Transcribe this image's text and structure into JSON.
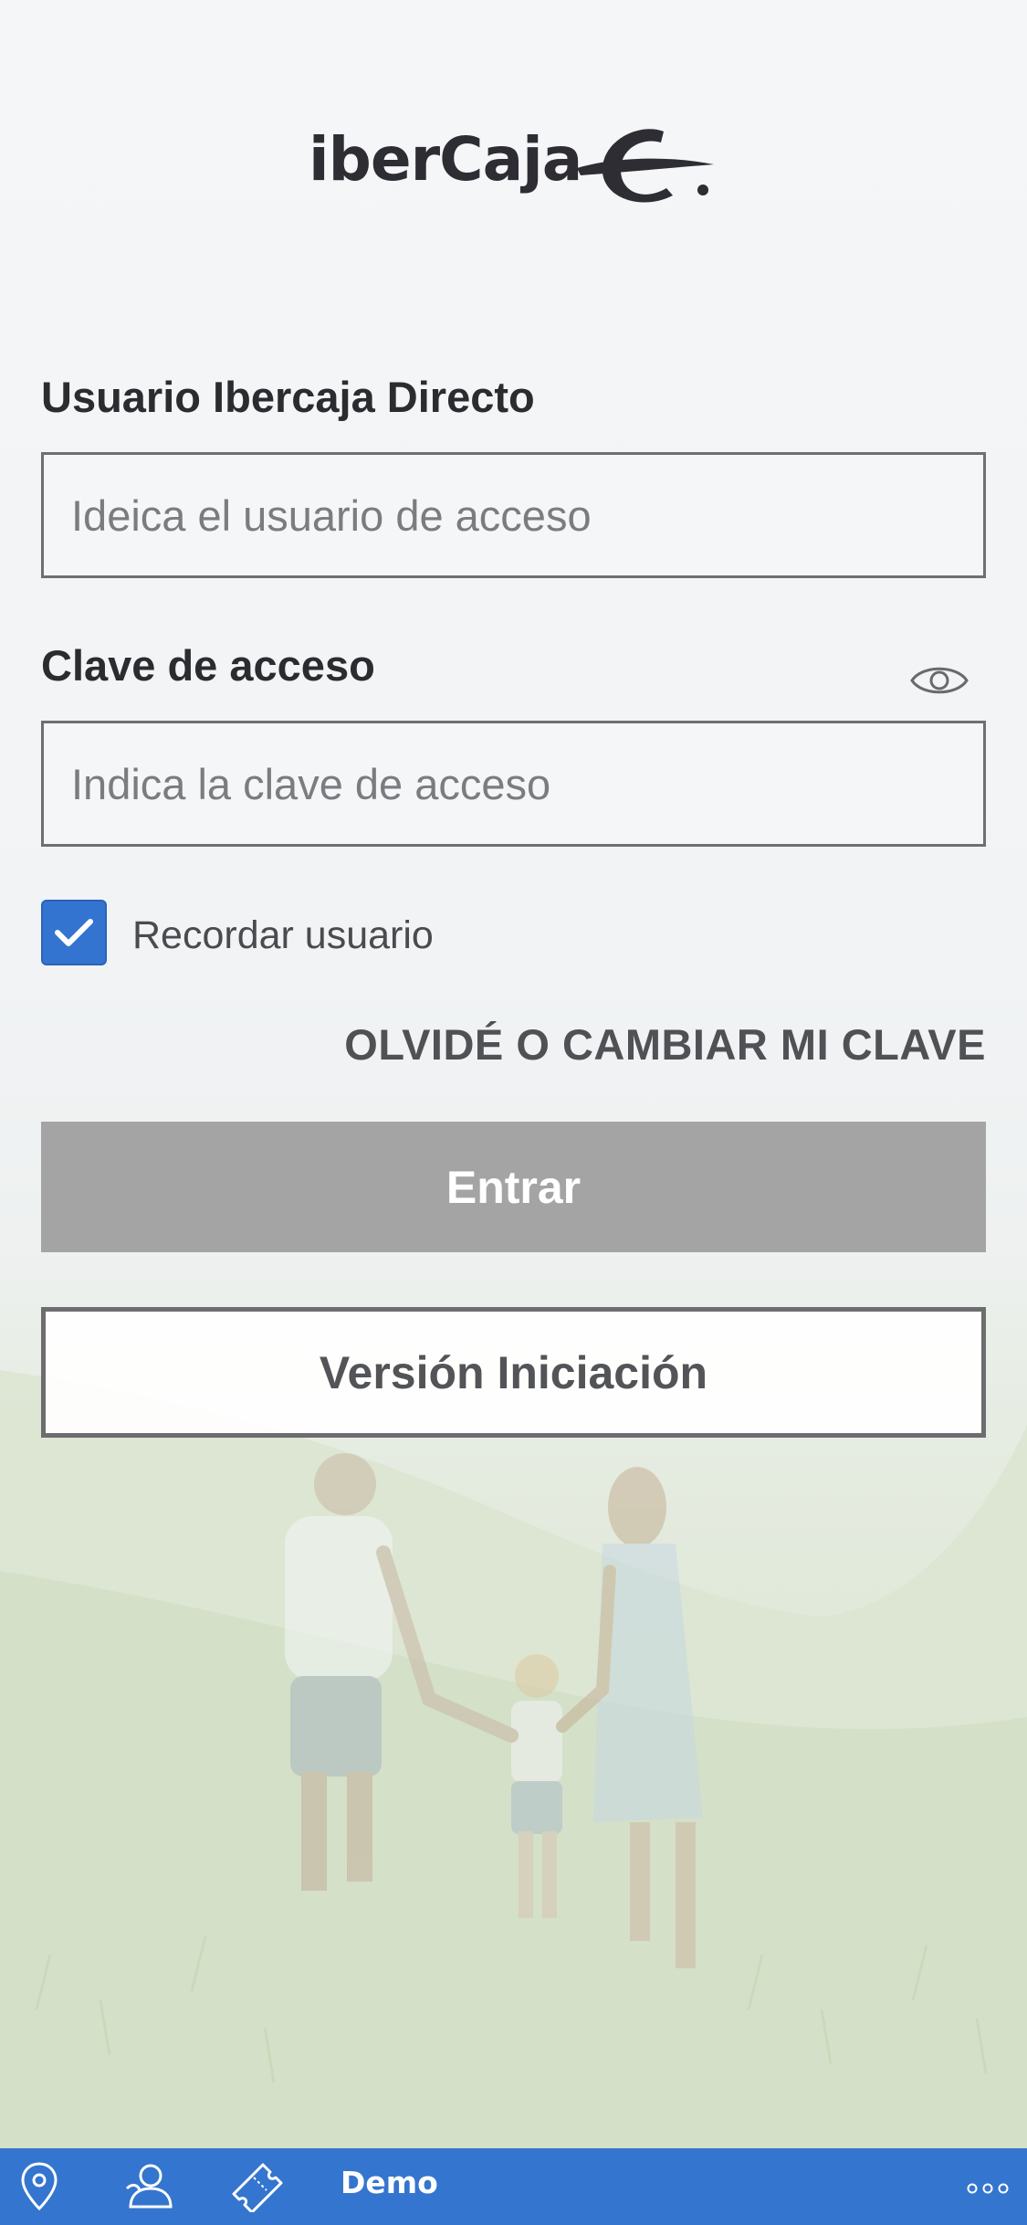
{
  "brand": {
    "logo_text": "iberCaja"
  },
  "login": {
    "user_label": "Usuario Ibercaja Directo",
    "user_placeholder": "Ideica el usuario de acceso",
    "user_value": "",
    "password_label": "Clave de acceso",
    "password_placeholder": "Indica la clave de acceso",
    "password_value": "",
    "remember_label": "Recordar usuario",
    "remember_checked": true,
    "forgot_link": "OLVIDÉ O CAMBIAR MI CLAVE",
    "enter_button": "Entrar",
    "beginner_button": "Versión Iniciación"
  },
  "bottom_bar": {
    "icons": [
      "location-pin-icon",
      "contact-person-icon",
      "ticket-icon"
    ],
    "demo_label": "Demo",
    "more_icon": "more-dots-icon"
  },
  "colors": {
    "accent": "#3475cf",
    "disabled_button": "#a4a4a5",
    "text_dark": "#2b2c30"
  }
}
